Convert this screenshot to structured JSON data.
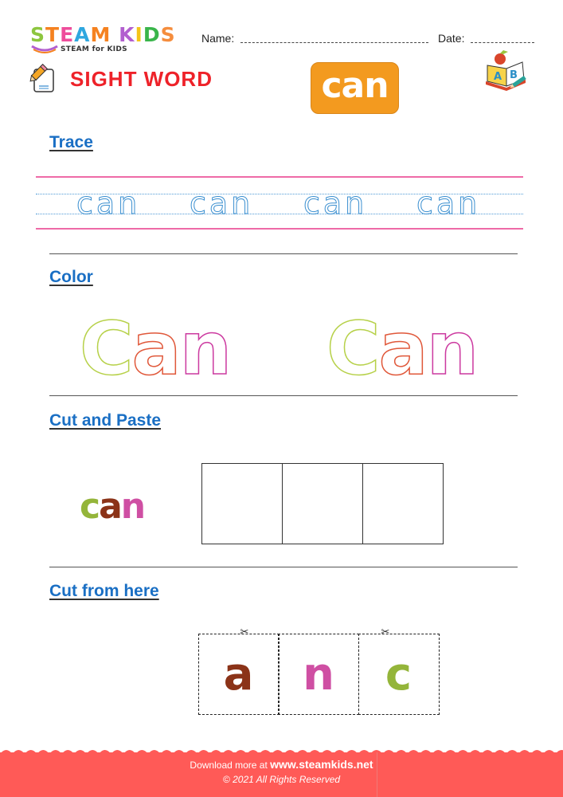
{
  "header": {
    "logo": {
      "title_letters": [
        {
          "ch": "S",
          "color": "#8dc63f"
        },
        {
          "ch": "T",
          "color": "#f58220"
        },
        {
          "ch": "E",
          "color": "#ee4d9b"
        },
        {
          "ch": "A",
          "color": "#2fa7df"
        },
        {
          "ch": "M",
          "color": "#f58220"
        },
        {
          "ch": " ",
          "color": "#ffffff"
        },
        {
          "ch": "K",
          "color": "#b25fcf"
        },
        {
          "ch": "I",
          "color": "#f5c518"
        },
        {
          "ch": "D",
          "color": "#39b54a"
        },
        {
          "ch": "S",
          "color": "#f58d3d"
        }
      ],
      "subtitle": "STEAM for KIDS"
    },
    "name_label": "Name:",
    "date_label": "Date:",
    "worksheet_type": "SIGHT WORD",
    "sight_word": "can",
    "accent_color": "#f39a1f"
  },
  "sections": {
    "trace": {
      "title": "Trace",
      "words": [
        "can",
        "can",
        "can",
        "can"
      ]
    },
    "color": {
      "title": "Color",
      "words": [
        {
          "c": "C",
          "a": "a",
          "n": "n"
        },
        {
          "c": "C",
          "a": "a",
          "n": "n"
        }
      ]
    },
    "cut_and_paste": {
      "title": "Cut and Paste",
      "sample": {
        "c": "c",
        "a": "a",
        "n": "n"
      },
      "box_count": 3
    },
    "cut_from_here": {
      "title": "Cut from here",
      "tiles": [
        {
          "letter": "a",
          "color": "#8b3318"
        },
        {
          "letter": "n",
          "color": "#cf4fa3"
        },
        {
          "letter": "c",
          "color": "#94b53a"
        }
      ],
      "scissors_icon": "✂"
    }
  },
  "footer": {
    "download_prefix": "Download more at",
    "site": "www.steamkids.net",
    "copyright": "© 2021 All Rights Reserved",
    "color": "#ff5a57"
  }
}
